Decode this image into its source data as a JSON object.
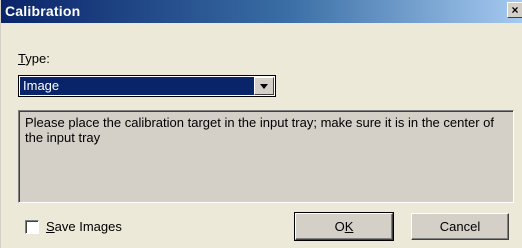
{
  "window": {
    "title": "Calibration",
    "close_label": "×"
  },
  "type_field": {
    "label_accel": "T",
    "label_rest": "ype:",
    "selected_value": "Image"
  },
  "message": {
    "text": "Please place the calibration target in the input tray; make sure it is in the center of the input tray"
  },
  "save_images": {
    "checked": false,
    "label_accel": "S",
    "label_rest": "ave Images"
  },
  "buttons": {
    "ok_prefix": "O",
    "ok_accel": "K",
    "cancel_label": "Cancel"
  }
}
